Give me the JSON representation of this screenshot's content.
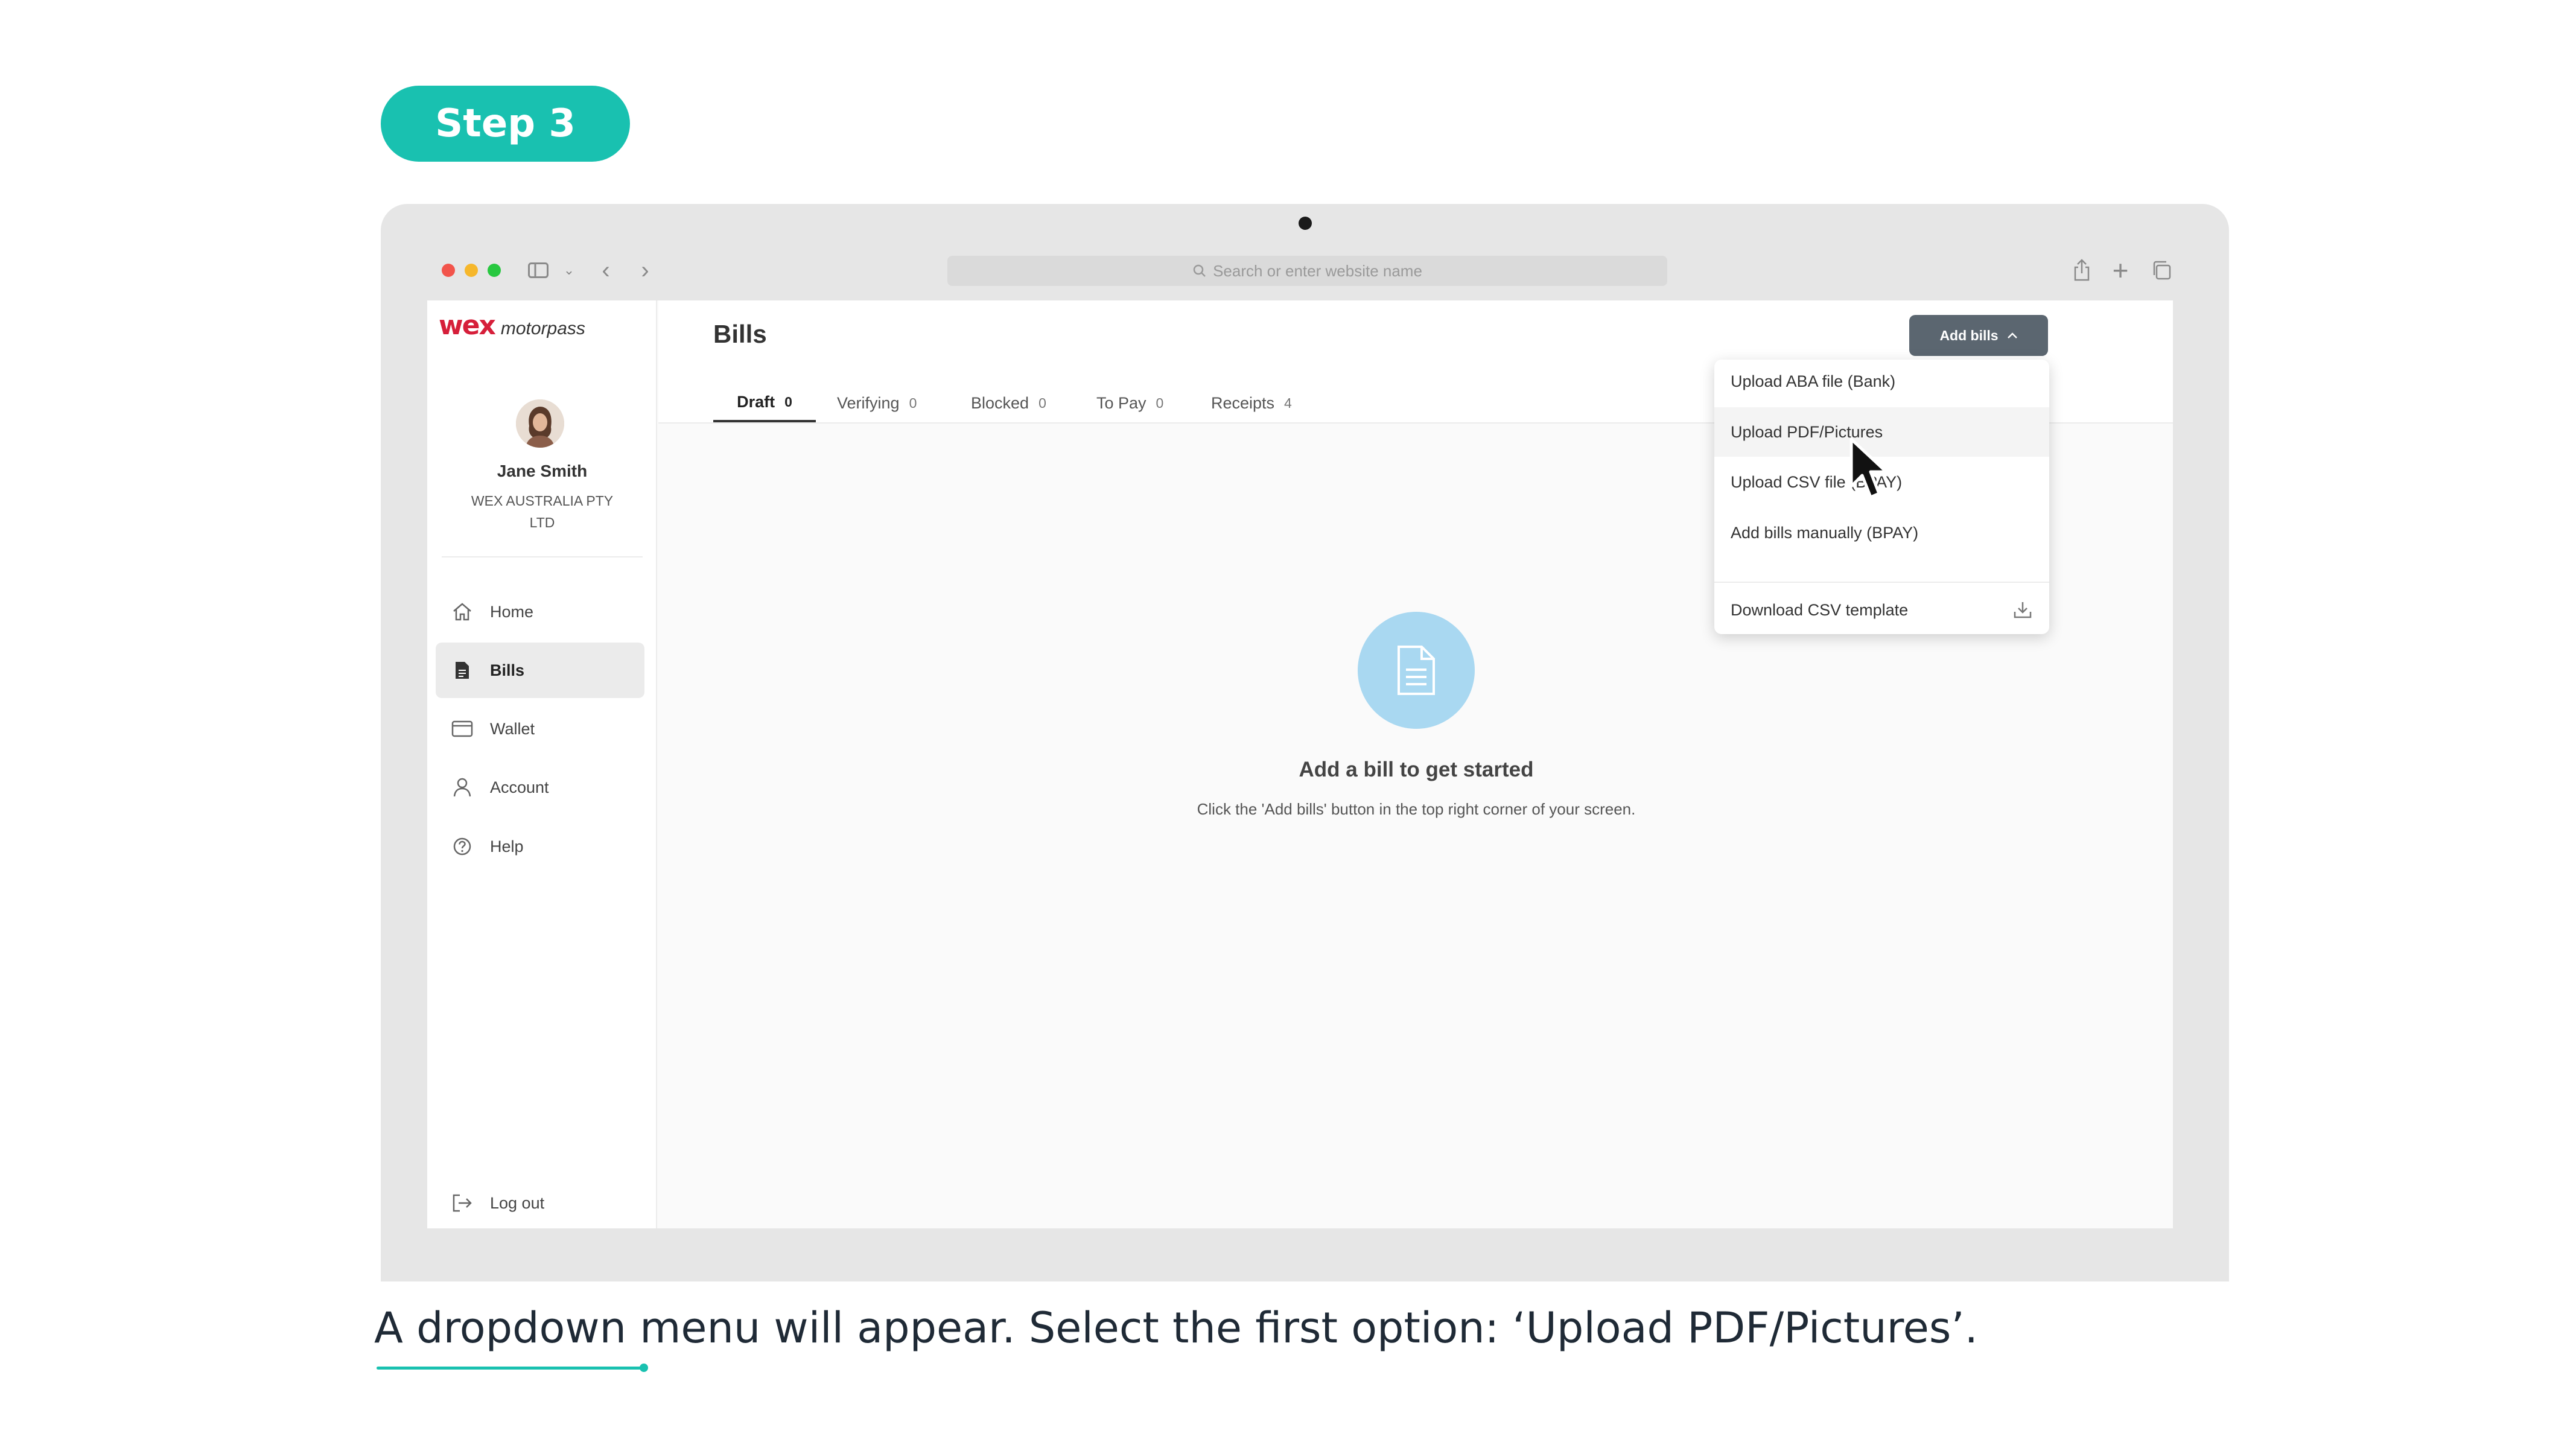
{
  "step_label": "Step 3",
  "caption": "A dropdown menu will appear. Select the first option: ‘Upload PDF/Pictures’.",
  "browser": {
    "address_placeholder": "Search or enter website name"
  },
  "brand": {
    "wex": "wex",
    "motorpass": "motorpass",
    "accent_color": "#19c1b0",
    "logo_color": "#d61f3a"
  },
  "user": {
    "name": "Jane Smith",
    "company": "WEX AUSTRALIA PTY LTD"
  },
  "sidebar": {
    "items": [
      {
        "label": "Home",
        "icon": "home-icon"
      },
      {
        "label": "Bills",
        "icon": "bill-icon",
        "active": true
      },
      {
        "label": "Wallet",
        "icon": "wallet-icon"
      },
      {
        "label": "Account",
        "icon": "user-icon"
      },
      {
        "label": "Help",
        "icon": "help-icon"
      }
    ],
    "logout": "Log out"
  },
  "main": {
    "title": "Bills",
    "tabs": [
      {
        "label": "Draft",
        "count": "0",
        "active": true
      },
      {
        "label": "Verifying",
        "count": "0"
      },
      {
        "label": "Blocked",
        "count": "0"
      },
      {
        "label": "To Pay",
        "count": "0"
      },
      {
        "label": "Receipts",
        "count": "4"
      }
    ],
    "add_bills_label": "Add bills",
    "empty_title": "Add a bill to get started",
    "empty_desc": "Click the 'Add bills' button in the top right corner of your screen."
  },
  "dropdown": {
    "items": [
      "Upload ABA file (Bank)",
      "Upload PDF/Pictures",
      "Upload CSV file (BPAY)",
      "Add bills manually (BPAY)"
    ],
    "download_label": "Download CSV template"
  }
}
